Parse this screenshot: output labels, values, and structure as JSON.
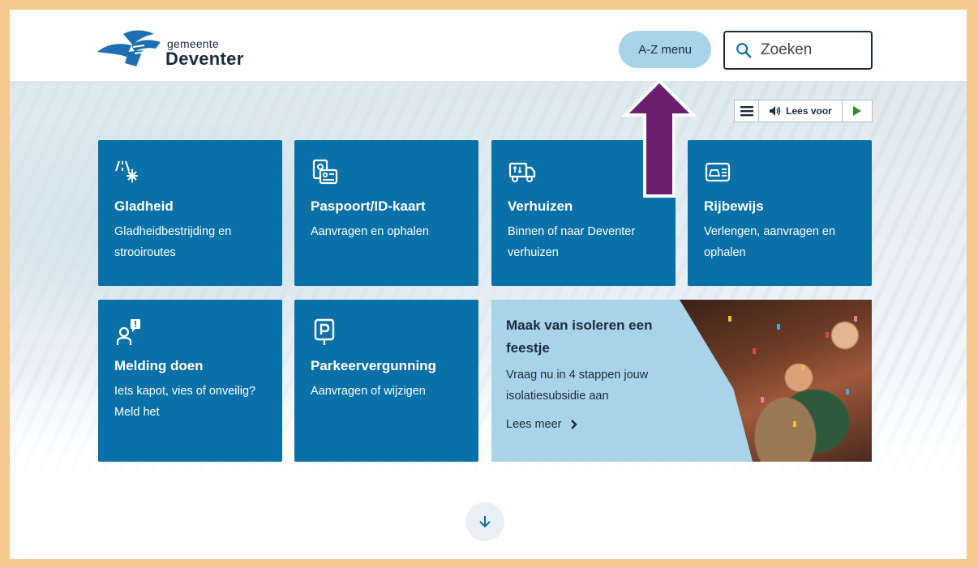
{
  "header": {
    "logo_small": "gemeente",
    "logo_big": "Deventer",
    "az_menu_label": "A-Z menu",
    "search_placeholder": "Zoeken"
  },
  "readspeaker": {
    "label": "Lees voor"
  },
  "tiles": [
    {
      "title": "Gladheid",
      "subtitle": "Gladheidbestrijding en strooiroutes",
      "icon": "snow-road-icon"
    },
    {
      "title": "Paspoort/ID-kaart",
      "subtitle": "Aanvragen en ophalen",
      "icon": "passport-id-icon"
    },
    {
      "title": "Verhuizen",
      "subtitle": "Binnen of naar Deventer verhuizen",
      "icon": "moving-truck-icon"
    },
    {
      "title": "Rijbewijs",
      "subtitle": "Verlengen, aanvragen en ophalen",
      "icon": "drivers-license-icon"
    },
    {
      "title": "Melding doen",
      "subtitle": "Iets kapot, vies of onveilig? Meld het",
      "icon": "report-person-icon"
    },
    {
      "title": "Parkeervergunning",
      "subtitle": "Aanvragen of wijzigen",
      "icon": "parking-icon"
    }
  ],
  "promo": {
    "title": "Maak van isoleren een feestje",
    "body": "Vraag nu in 4 stappen jouw isolatiesubsidie aan",
    "link": "Lees meer"
  },
  "colors": {
    "tile_blue": "#0a71a8",
    "promo_light_blue": "#a9d3e8",
    "frame_border": "#f3c98f",
    "annotation_arrow": "#6b1f6e",
    "play_green": "#2e8b2e"
  }
}
